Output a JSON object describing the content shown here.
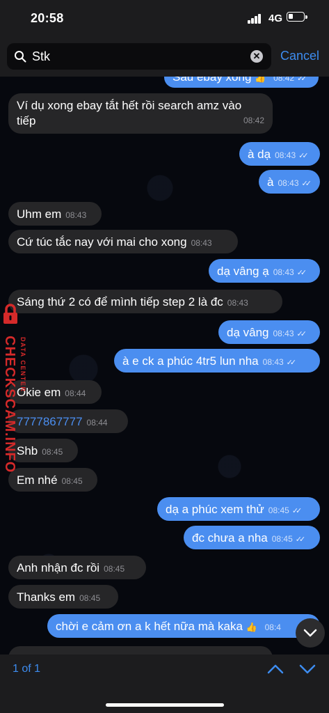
{
  "status": {
    "time": "20:58",
    "network": "4G"
  },
  "search": {
    "query": "Stk",
    "cancel_label": "Cancel"
  },
  "watermark": {
    "brand": "CHECKSCAM.INFO",
    "sub": "DATA CENTER"
  },
  "messages": [
    {
      "dir": "out",
      "text": "Sau ebay xong",
      "emoji": "👍",
      "time": "08:42",
      "partial": true
    },
    {
      "dir": "in",
      "text": "Ví dụ xong ebay tắt hết rồi search amz vào",
      "text2": "tiếp",
      "time": "08:42"
    },
    {
      "dir": "out",
      "text": "à dạ",
      "time": "08:43"
    },
    {
      "dir": "out",
      "text": "à",
      "time": "08:43"
    },
    {
      "dir": "in",
      "text": "Uhm em",
      "time": "08:43"
    },
    {
      "dir": "in",
      "text": "Cứ túc tắc nay với mai cho xong",
      "time": "08:43"
    },
    {
      "dir": "out",
      "text": "dạ vâng ạ",
      "time": "08:43"
    },
    {
      "dir": "in",
      "text": "Sáng thứ 2 có để mình tiếp step 2 là đc",
      "time": "08:43"
    },
    {
      "dir": "out",
      "text": "dạ vâng",
      "time": "08:43"
    },
    {
      "dir": "out",
      "text": "à e ck a phúc 4tr5 lun nha",
      "time": "08:43"
    },
    {
      "dir": "in",
      "text": "Okie em",
      "time": "08:44"
    },
    {
      "dir": "in",
      "text": "7777867777",
      "time": "08:44",
      "link": true
    },
    {
      "dir": "in",
      "text": "Shb",
      "time": "08:45"
    },
    {
      "dir": "in",
      "text": "Em nhé",
      "time": "08:45"
    },
    {
      "dir": "out",
      "text": "dạ a phúc xem thử",
      "time": "08:45"
    },
    {
      "dir": "out",
      "text": "đc chưa a nha",
      "time": "08:45"
    },
    {
      "dir": "in",
      "text": "Anh nhận đc rồi",
      "time": "08:45"
    },
    {
      "dir": "in",
      "text": "Thanks em",
      "time": "08:45"
    },
    {
      "dir": "out",
      "text": "chời e cảm ơn a k hết nữa mà kaka",
      "emoji": "👍",
      "time": "08:4"
    }
  ],
  "footer": {
    "result_count": "1 of 1"
  },
  "colors": {
    "accent": "#3d8cf0",
    "outgoing": "#4b8ef0",
    "incoming": "#262628",
    "watermark": "#d52a2a"
  },
  "icons": [
    "search-icon",
    "clear-icon",
    "chevron-up-icon",
    "chevron-down-icon",
    "scroll-down-icon",
    "lock-icon",
    "read-ticks-icon"
  ]
}
